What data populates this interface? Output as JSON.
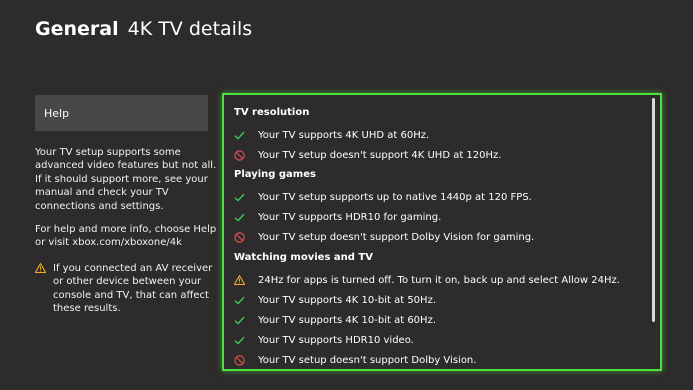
{
  "header": {
    "section": "General",
    "page_title": "4K TV details"
  },
  "sidebar": {
    "help_button": "Help",
    "description": "Your TV setup supports some advanced video features but not all. If it should support more, see your manual and check your TV connections and settings.",
    "help_info": "For help and more info, choose Help or visit xbox.com/xboxone/4k",
    "av_note": "If you connected an AV receiver or other device between your console and TV, that can affect these results."
  },
  "details": {
    "groups": [
      {
        "title": "TV resolution",
        "items": [
          {
            "status": "check-icon",
            "text": "Your TV supports 4K UHD at 60Hz."
          },
          {
            "status": "blocked-icon",
            "text": "Your TV setup doesn't support 4K UHD at 120Hz."
          }
        ]
      },
      {
        "title": "Playing games",
        "items": [
          {
            "status": "check-icon",
            "text": "Your TV setup supports up to native 1440p at 120 FPS."
          },
          {
            "status": "check-icon",
            "text": "Your TV supports HDR10 for gaming."
          },
          {
            "status": "blocked-icon",
            "text": "Your TV setup doesn't support Dolby Vision for gaming."
          }
        ]
      },
      {
        "title": "Watching movies and TV",
        "items": [
          {
            "status": "warning-icon",
            "text": "24Hz for apps is turned off. To turn it on, back up and select Allow 24Hz."
          },
          {
            "status": "check-icon",
            "text": "Your TV supports 4K 10-bit at 50Hz."
          },
          {
            "status": "check-icon",
            "text": "Your TV supports 4K 10-bit at 60Hz."
          },
          {
            "status": "check-icon",
            "text": "Your TV supports HDR10 video."
          },
          {
            "status": "blocked-icon",
            "text": "Your TV setup doesn't support Dolby Vision."
          }
        ]
      }
    ]
  },
  "colors": {
    "background": "#2d2b2b",
    "accent_green": "#4ae03d",
    "check_green": "#38c45a",
    "blocked_red": "#e0504a",
    "warning_yellow": "#f0b020"
  }
}
